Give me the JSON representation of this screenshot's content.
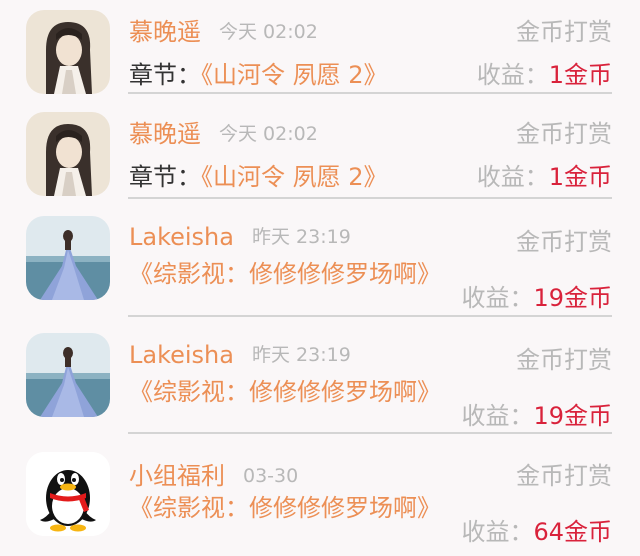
{
  "records": [
    {
      "avatar": "ink-painting-portrait",
      "name": "慕晚遥",
      "time": "今天 02:02",
      "action": "金币打赏",
      "chapter_label": "章节：",
      "title": "《山河令 夙愿 2》",
      "earn_label": "收益：",
      "earn_value": "1金币"
    },
    {
      "avatar": "ink-painting-portrait",
      "name": "慕晚遥",
      "time": "今天 02:02",
      "action": "金币打赏",
      "chapter_label": "章节：",
      "title": "《山河令 夙愿 2》",
      "earn_label": "收益：",
      "earn_value": "1金币"
    },
    {
      "avatar": "woman-blue-dress-sea",
      "name": "Lakeisha",
      "time": "昨天 23:19",
      "action": "金币打赏",
      "title": "《综影视：修修修修罗场啊》",
      "earn_label": "收益：",
      "earn_value": "19金币"
    },
    {
      "avatar": "woman-blue-dress-sea",
      "name": "Lakeisha",
      "time": "昨天 23:19",
      "action": "金币打赏",
      "title": "《综影视：修修修修罗场啊》",
      "earn_label": "收益：",
      "earn_value": "19金币"
    },
    {
      "avatar": "qq-penguin-logo",
      "name": "小组福利",
      "time": "03-30",
      "action": "金币打赏",
      "title": "《综影视：修修修修罗场啊》",
      "earn_label": "收益：",
      "earn_value": "64金币"
    }
  ]
}
